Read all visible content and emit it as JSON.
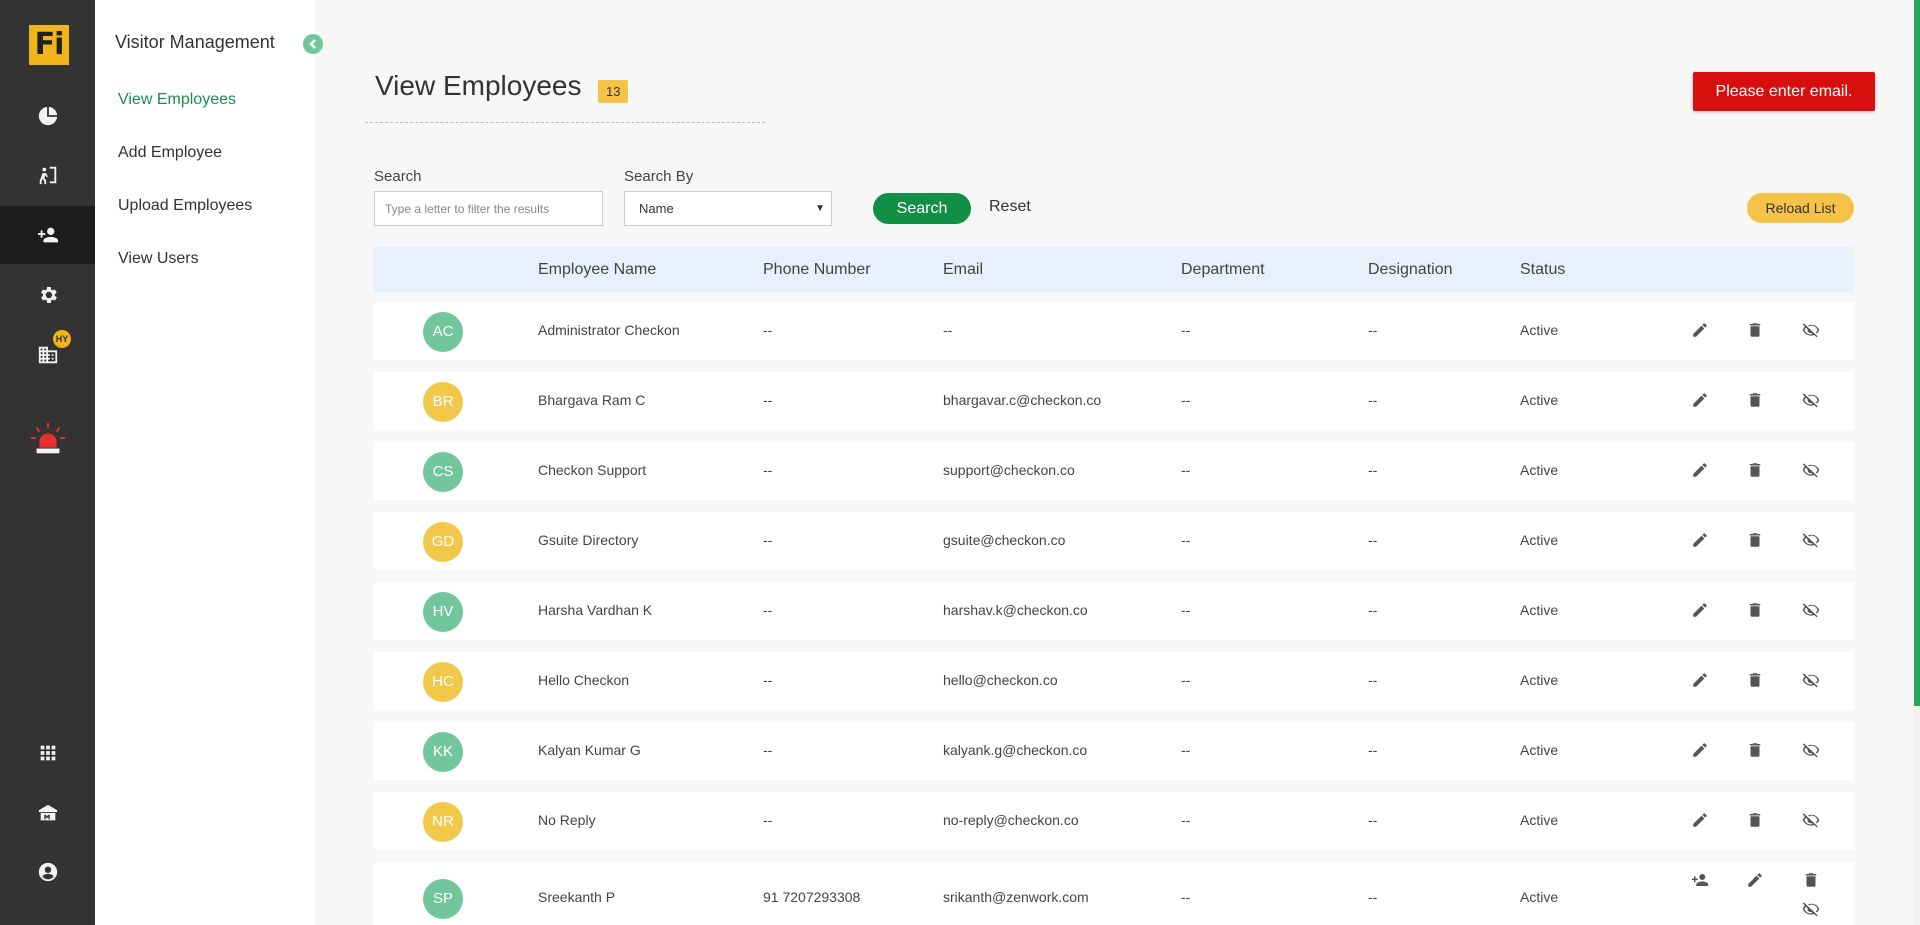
{
  "app": {
    "logo_text": "Fi",
    "badge": "HY"
  },
  "rail": {
    "items": [
      {
        "icon": "dashboard-pie-icon"
      },
      {
        "icon": "visitor-entry-icon"
      },
      {
        "icon": "add-user-icon"
      },
      {
        "icon": "gear-icon"
      },
      {
        "icon": "building-icon"
      },
      {
        "icon": "alarm-icon"
      },
      {
        "icon": "apps-grid-icon"
      },
      {
        "icon": "home-office-icon"
      },
      {
        "icon": "account-icon"
      }
    ]
  },
  "subnav": {
    "title": "Visitor Management",
    "items": [
      {
        "label": "View Employees",
        "active": true
      },
      {
        "label": "Add Employee"
      },
      {
        "label": "Upload Employees"
      },
      {
        "label": "View Users"
      }
    ]
  },
  "page": {
    "title": "View Employees",
    "count": "13",
    "alert": "Please enter email."
  },
  "filters": {
    "search_label": "Search",
    "search_placeholder": "Type a letter to filter the results",
    "search_value": "",
    "search_by_label": "Search By",
    "search_by_value": "Name",
    "search_button": "Search",
    "reset_button": "Reset",
    "reload_button": "Reload List"
  },
  "table": {
    "headers": [
      "Employee Name",
      "Phone Number",
      "Email",
      "Department",
      "Designation",
      "Status"
    ],
    "rows": [
      {
        "initials": "AC",
        "name": "Administrator Checkon",
        "phone": "--",
        "email": "--",
        "department": "--",
        "designation": "--",
        "status": "Active",
        "color": "green"
      },
      {
        "initials": "BR",
        "name": "Bhargava Ram C",
        "phone": "--",
        "email": "bhargavar.c@checkon.co",
        "department": "--",
        "designation": "--",
        "status": "Active",
        "color": "yellow"
      },
      {
        "initials": "CS",
        "name": "Checkon Support",
        "phone": "--",
        "email": "support@checkon.co",
        "department": "--",
        "designation": "--",
        "status": "Active",
        "color": "green"
      },
      {
        "initials": "GD",
        "name": "Gsuite Directory",
        "phone": "--",
        "email": "gsuite@checkon.co",
        "department": "--",
        "designation": "--",
        "status": "Active",
        "color": "yellow"
      },
      {
        "initials": "HV",
        "name": "Harsha Vardhan K",
        "phone": "--",
        "email": "harshav.k@checkon.co",
        "department": "--",
        "designation": "--",
        "status": "Active",
        "color": "green"
      },
      {
        "initials": "HC",
        "name": "Hello Checkon",
        "phone": "--",
        "email": "hello@checkon.co",
        "department": "--",
        "designation": "--",
        "status": "Active",
        "color": "yellow"
      },
      {
        "initials": "KK",
        "name": "Kalyan Kumar G",
        "phone": "--",
        "email": "kalyank.g@checkon.co",
        "department": "--",
        "designation": "--",
        "status": "Active",
        "color": "green"
      },
      {
        "initials": "NR",
        "name": "No Reply",
        "phone": "--",
        "email": "no-reply@checkon.co",
        "department": "--",
        "designation": "--",
        "status": "Active",
        "color": "yellow"
      },
      {
        "initials": "SP",
        "name": "Sreekanth P",
        "phone": "91 7207293308",
        "email": "srikanth@zenwork.com",
        "department": "--",
        "designation": "--",
        "status": "Active",
        "color": "green"
      }
    ]
  },
  "colors": {
    "green_avatar": "#72c69b",
    "yellow_avatar": "#f2c84b",
    "accent_green": "#138f45",
    "alert_red": "#d80f0f",
    "badge_yellow": "#f7c248"
  }
}
